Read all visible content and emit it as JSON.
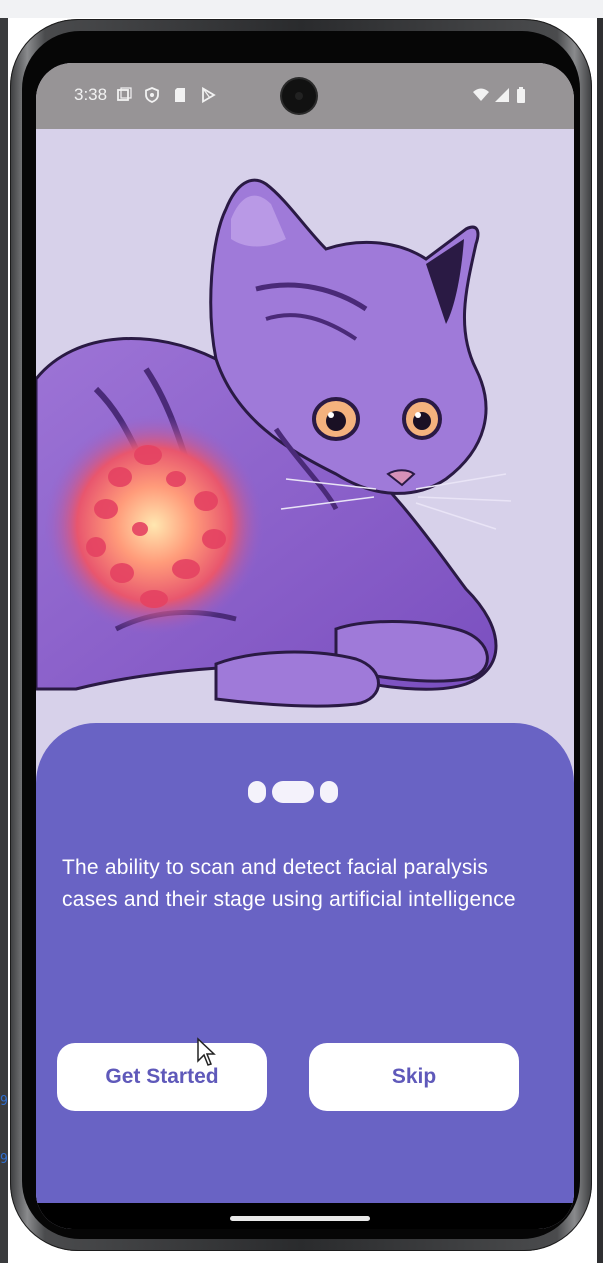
{
  "status_bar": {
    "time": "3:38",
    "left_icons": [
      "screen-record-icon",
      "shield-icon",
      "sim-card-icon",
      "play-store-icon"
    ],
    "right_icons": [
      "wifi-icon",
      "signal-icon",
      "battery-icon"
    ]
  },
  "onboarding": {
    "illustration": "cat-illustration",
    "page_indicator": {
      "total": 3,
      "active_index": 1
    },
    "description": "The ability to scan and detect facial paralysis cases and their stage using artificial intelligence",
    "buttons": {
      "get_started": "Get Started",
      "skip": "Skip"
    }
  },
  "colors": {
    "panel": "#6963c4",
    "background": "#d7d1ea",
    "button_text": "#5f59ba",
    "status_bar": "#979496"
  },
  "backdrop": {
    "code_fragments": [
      "9",
      "9"
    ]
  }
}
